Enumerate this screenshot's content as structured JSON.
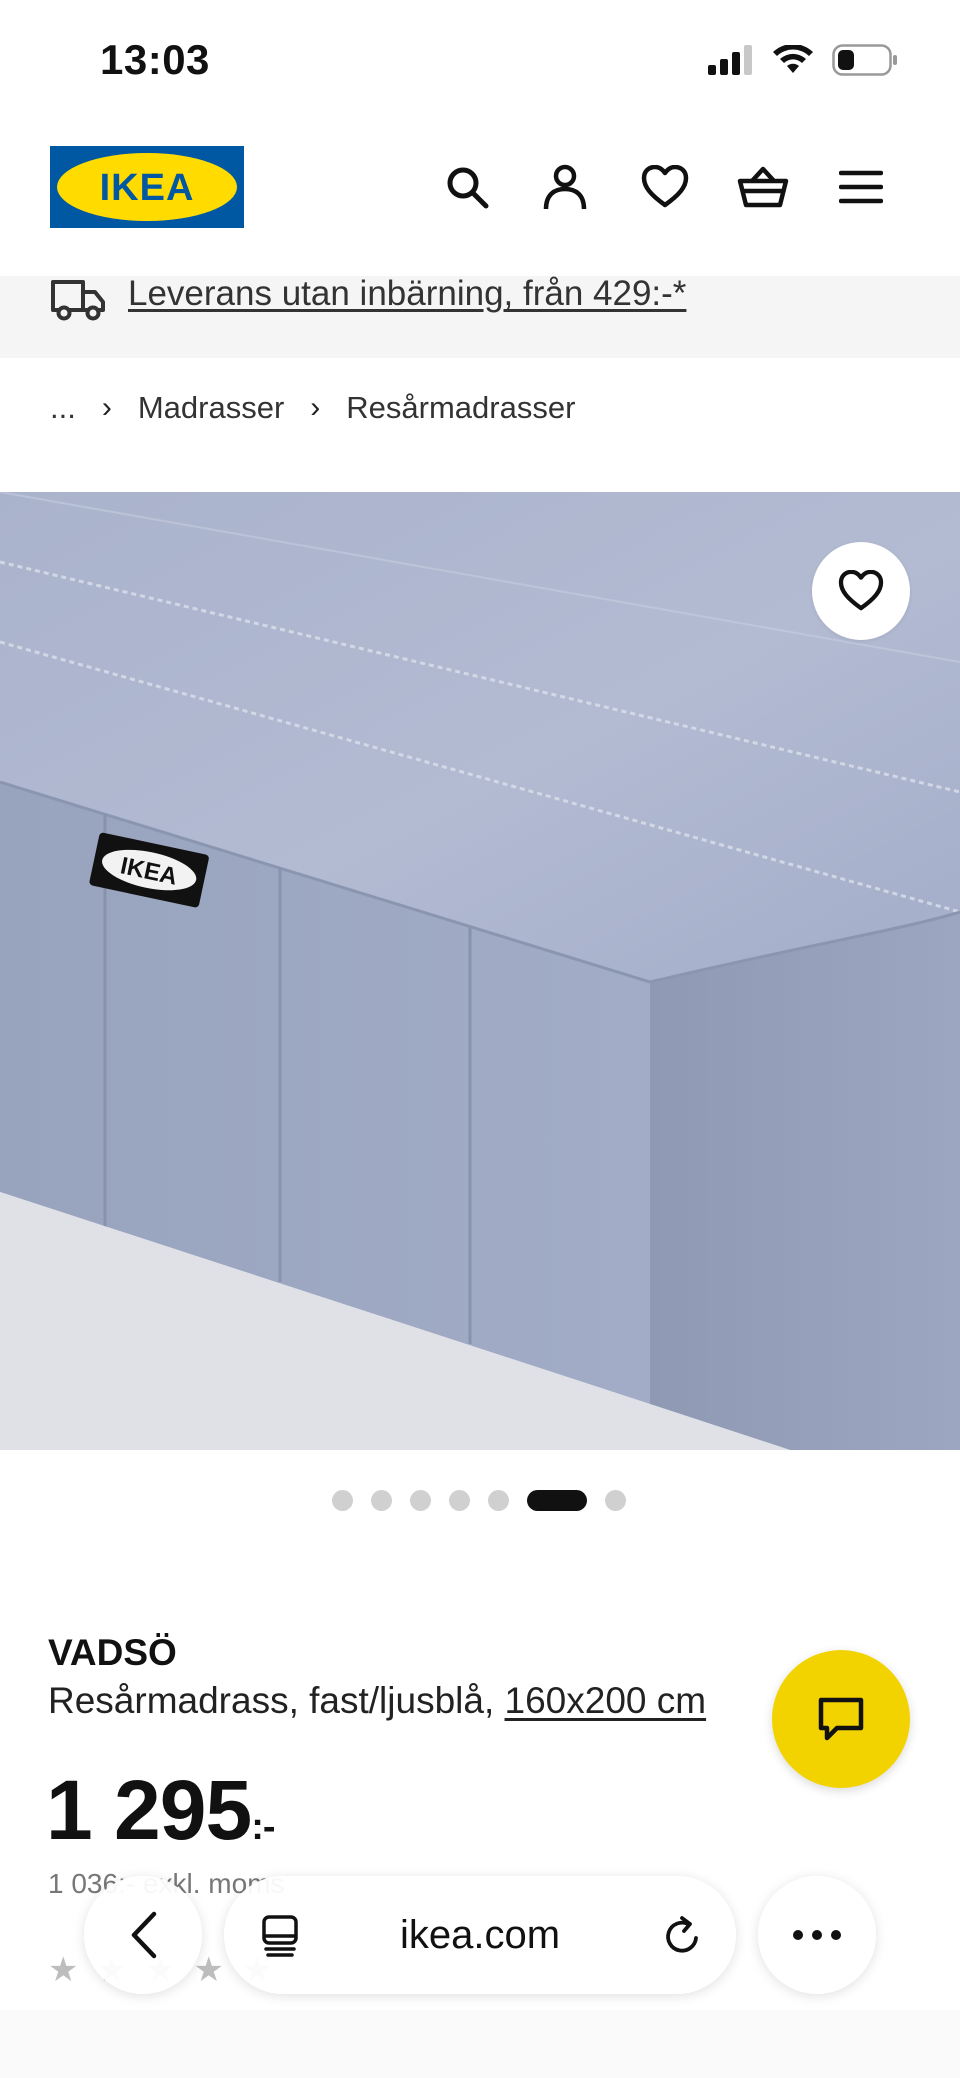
{
  "status_bar": {
    "time": "13:03"
  },
  "header": {
    "logo_text": "IKEA",
    "icons": [
      "search-icon",
      "account-icon",
      "heart-icon",
      "basket-icon",
      "menu-icon"
    ]
  },
  "banner": {
    "text": "Leverans utan inbärning, från 429:-*",
    "icon": "truck-icon"
  },
  "breadcrumb": {
    "ellipsis": "...",
    "items": [
      "Madrasser",
      "Resårmadrasser"
    ]
  },
  "gallery": {
    "image_label": "IKEA",
    "total_images": 7,
    "active_index": 5
  },
  "product": {
    "name": "VADSÖ",
    "description": "Resårmadrass, fast/ljusblå, ",
    "size": "160x200 cm",
    "price": "1 295",
    "currency": ":-",
    "price_ex_vat": "1 036:- exkl. moms"
  },
  "toolbar": {
    "url": "ikea.com"
  },
  "colors": {
    "brand_blue": "#0058A3",
    "brand_yellow": "#FFDB00",
    "chat_yellow": "#F2D300"
  }
}
